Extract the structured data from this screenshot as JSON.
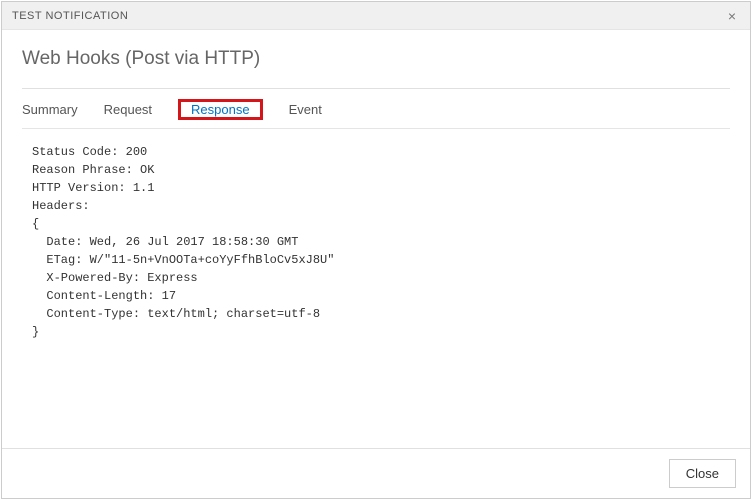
{
  "titlebar": {
    "title": "TEST NOTIFICATION",
    "close": "×"
  },
  "heading": "Web Hooks (Post via HTTP)",
  "tabs": {
    "summary": "Summary",
    "request": "Request",
    "response": "Response",
    "event": "Event",
    "active": "response"
  },
  "response_text": "Status Code: 200\nReason Phrase: OK\nHTTP Version: 1.1\nHeaders:\n{\n  Date: Wed, 26 Jul 2017 18:58:30 GMT\n  ETag: W/\"11-5n+VnOOTa+coYyFfhBloCv5xJ8U\"\n  X-Powered-By: Express\n  Content-Length: 17\n  Content-Type: text/html; charset=utf-8\n}",
  "footer": {
    "close_label": "Close"
  }
}
